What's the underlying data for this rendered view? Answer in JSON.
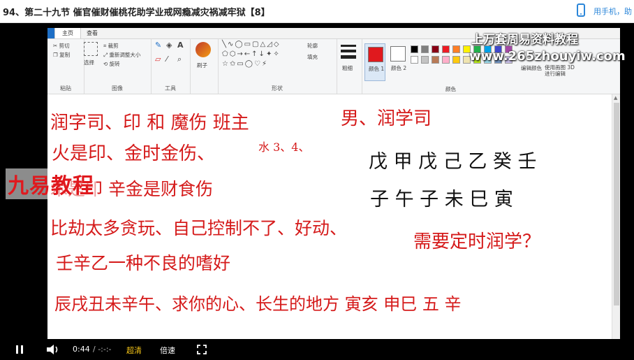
{
  "page_title": "94、第二十九节 催官催财催桃花助学业戒网瘾减灾祸减牢狱【8】",
  "mobile_link": "用手机，助",
  "paint": {
    "tabs": [
      "主页",
      "查看"
    ],
    "clipboard": {
      "cut": "剪切",
      "copy": "复制",
      "label": "粘贴"
    },
    "image": {
      "select": "选择",
      "crop": "裁剪",
      "resize": "重新调整大小",
      "rotate": "旋转",
      "label": "图像"
    },
    "tools": {
      "label": "工具"
    },
    "brush": {
      "label": "刷子"
    },
    "shapes": {
      "outline": "轮廓",
      "fill": "填充",
      "label": "形状"
    },
    "size_label": "粗细",
    "color1_label": "颜色 1",
    "color2_label": "颜色 2",
    "edit_colors": "编辑颜色",
    "paint3d": "使用画图 3D 进行编辑",
    "colors_label": "颜色",
    "palette": [
      "#000000",
      "#7f7f7f",
      "#880015",
      "#ed1c24",
      "#ff7f27",
      "#fff200",
      "#22b14c",
      "#00a2e8",
      "#3f48cc",
      "#a349a4",
      "#ffffff",
      "#c3c3c3",
      "#b97a57",
      "#ffaec9",
      "#ffc90e",
      "#efe4b0",
      "#b5e61d",
      "#99d9ea",
      "#7092be",
      "#c8bfe7"
    ]
  },
  "handwriting": [
    {
      "text": "润字司、印 和 魔伤 班主",
      "color": "red"
    },
    {
      "text": "男、润学司",
      "color": "red"
    },
    {
      "text": "火是印、金时金伤、",
      "color": "red"
    },
    {
      "text": "水 3、4、",
      "color": "red"
    },
    {
      "text": "戊 甲 戊 己 乙 癸 壬",
      "color": "black"
    },
    {
      "text": "子 午 子 未 巳 寅",
      "color": "black"
    },
    {
      "text": "木是印 辛金是财食伤",
      "color": "red"
    },
    {
      "text": "比劫太多贪玩、自己控制不了、好动、",
      "color": "red"
    },
    {
      "text": "需要定时润学？",
      "color": "red"
    },
    {
      "text": "壬辛乙一种不良的嗜好",
      "color": "red"
    },
    {
      "text": "辰戌丑未辛午、求你的心、长生的地方 寅亥 申巳 五 辛",
      "color": "red"
    }
  ],
  "player": {
    "current_time": "0:44",
    "duration": "/ -:-:-",
    "quality": "超清",
    "speed": "倍速"
  },
  "watermark": {
    "line1": "上万套周易资料教程",
    "line2": "www.265zhouyiw.com"
  },
  "logo": "九易教程"
}
